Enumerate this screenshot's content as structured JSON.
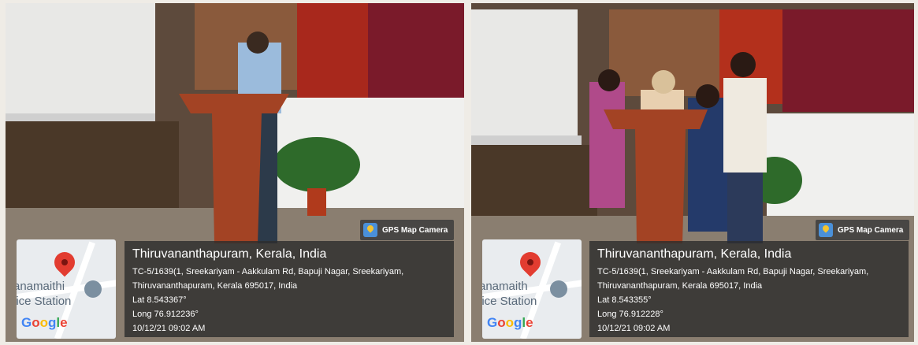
{
  "photos": [
    {
      "badge": "GPS Map Camera",
      "map": {
        "place_line1": "anamaithi",
        "place_line2": "lice Station",
        "logo": "Google"
      },
      "city": "Thiruvananthapuram, Kerala, India",
      "address_line1": "TC-5/1639(1, Sreekariyam - Aakkulam Rd, Bapuji Nagar, Sreekariyam,",
      "address_line2": "Thiruvananthapuram, Kerala 695017, India",
      "lat": "Lat 8.543367°",
      "long": "Long 76.912236°",
      "datetime": "10/12/21 09:02 AM"
    },
    {
      "badge": "GPS Map Camera",
      "map": {
        "place_line1": "anamaith",
        "place_line2": "lice Station",
        "logo": "Google"
      },
      "city": "Thiruvananthapuram, Kerala, India",
      "address_line1": "TC-5/1639(1, Sreekariyam - Aakkulam Rd, Bapuji Nagar, Sreekariyam,",
      "address_line2": "Thiruvananthapuram, Kerala 695017, India",
      "lat": "Lat 8.543355°",
      "long": "Long 76.912228°",
      "datetime": "10/12/21 09:02 AM"
    }
  ]
}
